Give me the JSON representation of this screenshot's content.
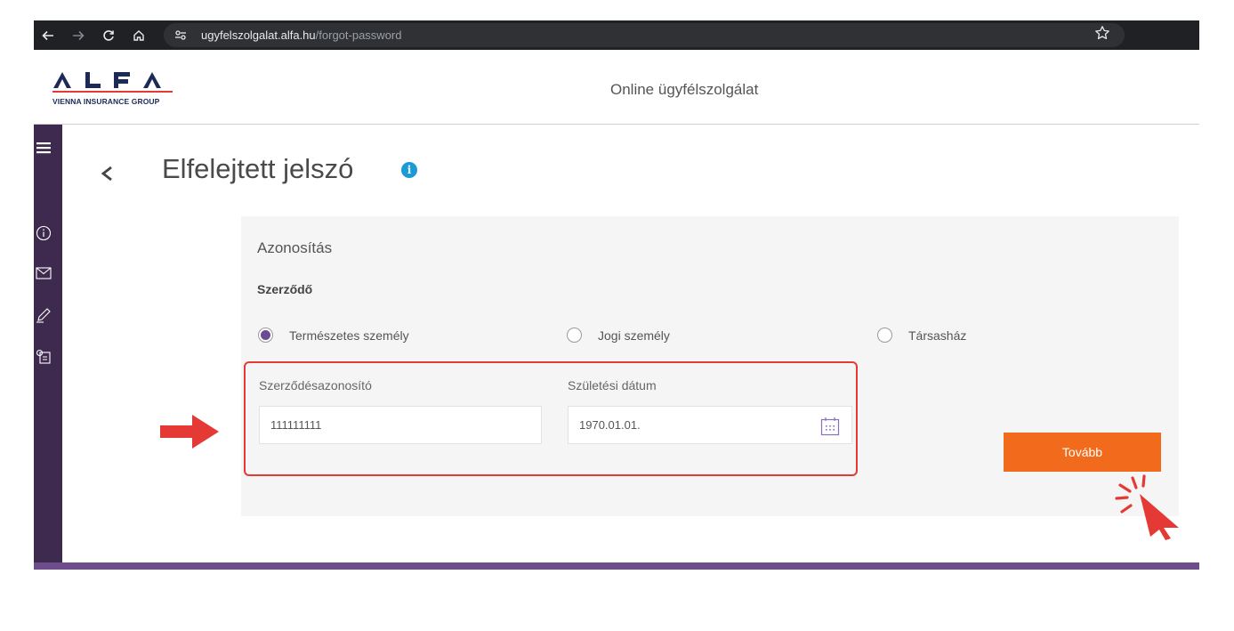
{
  "browser": {
    "url_domain": "ugyfelszolgalat.alfa.hu",
    "url_path": "/forgot-password"
  },
  "header": {
    "logo_text": "ALFA",
    "logo_tagline": "VIENNA INSURANCE GROUP",
    "title": "Online ügyfélszolgálat"
  },
  "page": {
    "title": "Elfelejtett jelszó"
  },
  "form": {
    "section_title": "Azonosítás",
    "subsection_title": "Szerződő",
    "radios": [
      {
        "label": "Természetes személy",
        "selected": true
      },
      {
        "label": "Jogi személy",
        "selected": false
      },
      {
        "label": "Társasház",
        "selected": false
      }
    ],
    "contract_id_label": "Szerződésazonosító",
    "contract_id_value": "111111111",
    "birth_date_label": "Születési dátum",
    "birth_date_value": "1970.01.01.",
    "next_label": "Tovább"
  },
  "colors": {
    "accent_orange": "#f26a1b",
    "sidebar_purple": "#3d2a4e",
    "radio_purple": "#6a4c93",
    "info_blue": "#1a9bd7",
    "annotation_red": "#e53935"
  }
}
